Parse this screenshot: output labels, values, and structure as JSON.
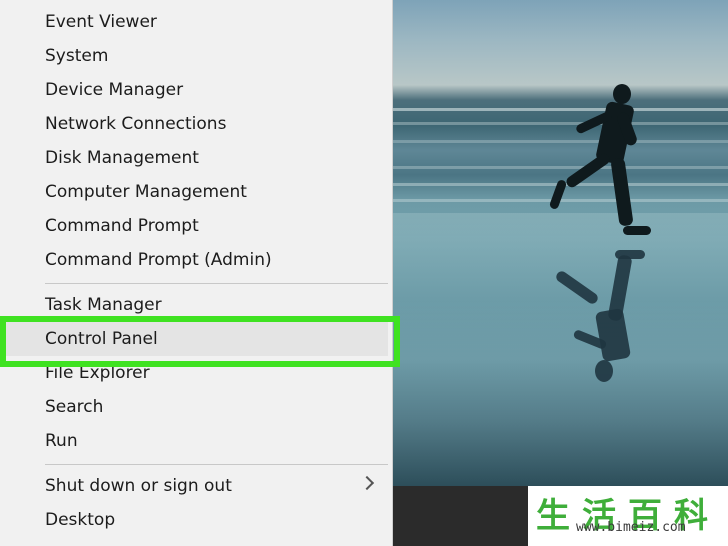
{
  "menu": {
    "items": [
      {
        "label": "Event Viewer"
      },
      {
        "label": "System"
      },
      {
        "label": "Device Manager"
      },
      {
        "label": "Network Connections"
      },
      {
        "label": "Disk Management"
      },
      {
        "label": "Computer Management"
      },
      {
        "label": "Command Prompt"
      },
      {
        "label": "Command Prompt (Admin)"
      },
      {
        "label": "Task Manager"
      },
      {
        "label": "Control Panel"
      },
      {
        "label": "File Explorer"
      },
      {
        "label": "Search"
      },
      {
        "label": "Run"
      },
      {
        "label": "Shut down or sign out"
      },
      {
        "label": "Desktop"
      }
    ],
    "highlighted": "Control Panel"
  },
  "watermark": {
    "characters": "生活百科",
    "url": "www.bimeiz.com"
  },
  "colors": {
    "highlight_border": "#3fe221",
    "menu_background": "#f1f1f1"
  }
}
